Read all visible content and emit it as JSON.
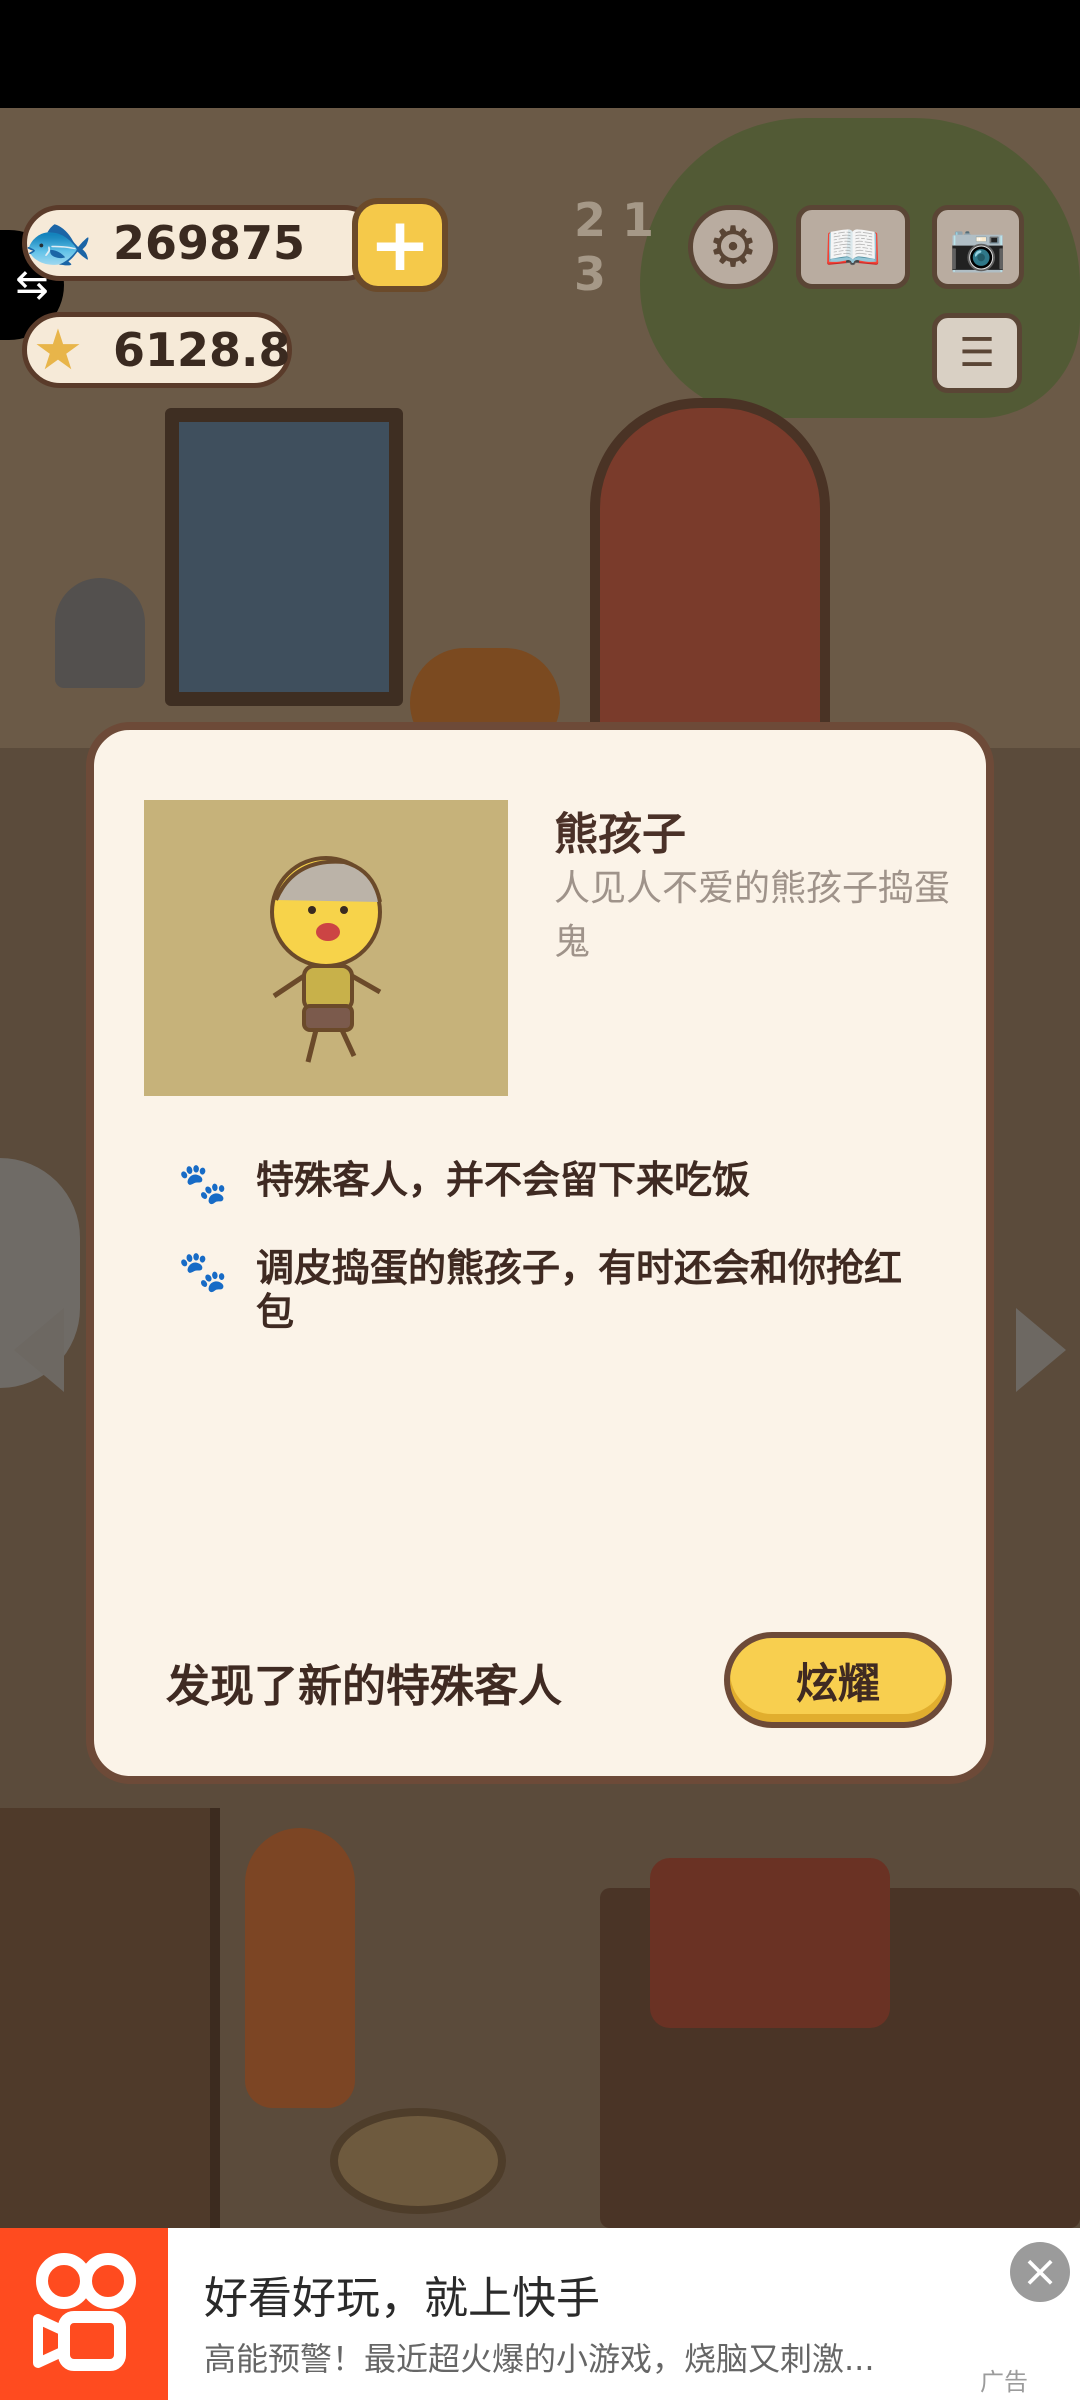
{
  "hud": {
    "fish_currency": "269875",
    "star_currency": "6128.8",
    "add_symbol": "+",
    "rank_label": "2 1 3"
  },
  "modal": {
    "character_name": "熊孩子",
    "character_desc": "人见人不爱的熊孩子捣蛋鬼",
    "traits": [
      "特殊客人，并不会留下来吃饭",
      "调皮捣蛋的熊孩子，有时还会和你抢红包"
    ],
    "discover_text": "发现了新的特殊客人",
    "show_off_label": "炫耀"
  },
  "ad": {
    "title": "好看好玩，就上快手",
    "subtitle": "高能预警！最近超火爆的小游戏，烧脑又刺激...",
    "label": "广告"
  },
  "colors": {
    "modal_bg": "#fbf3e8",
    "modal_border": "#6d4a38",
    "button_yellow": "#f8cf4f",
    "ad_brand": "#ff4b1f"
  },
  "icons": [
    "fish-icon",
    "star-icon",
    "plus-icon",
    "rank-icon",
    "settings-icon",
    "book-icon",
    "camera-icon",
    "news-icon",
    "paw-icon",
    "close-icon",
    "kuaishou-logo"
  ]
}
